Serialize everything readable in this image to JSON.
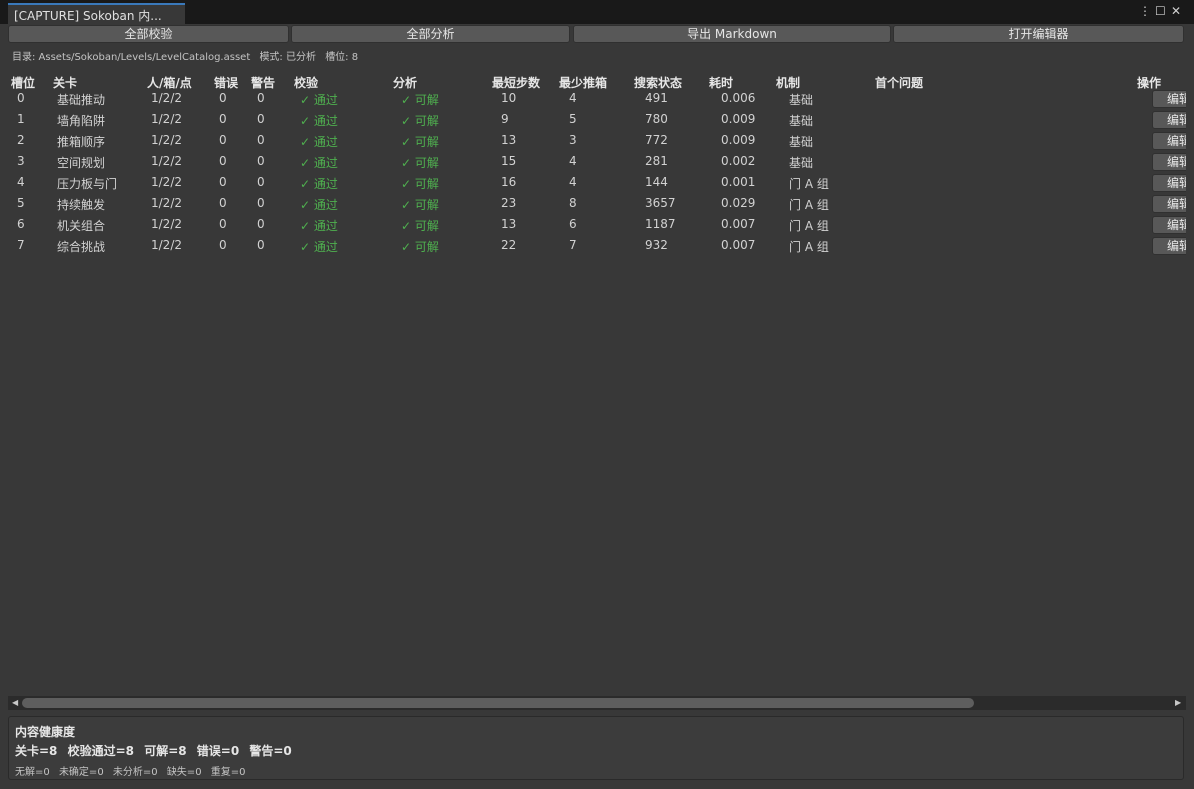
{
  "window": {
    "tab_title": "[CAPTURE] Sokoban 内...",
    "menu_glyph": "⋮",
    "maximize_glyph": "☐",
    "close_glyph": "✕"
  },
  "toolbar": {
    "validate_all": "全部校验",
    "analyze_all": "全部分析",
    "export_markdown": "导出 Markdown",
    "open_editor": "打开编辑器"
  },
  "info": {
    "catalog": "目录: Assets/Sokoban/Levels/LevelCatalog.asset",
    "mode": "模式: 已分析",
    "slots": "槽位: 8"
  },
  "table": {
    "headers": [
      "槽位",
      "关卡",
      "人/箱/点",
      "错误",
      "警告",
      "校验",
      "分析",
      "最短步数",
      "最少推箱",
      "搜索状态",
      "耗时",
      "机制",
      "首个问题",
      "操作"
    ],
    "rows": [
      {
        "slot": "0",
        "level": "基础推动",
        "pbg": "1/2/2",
        "errors": "0",
        "warnings": "0",
        "validation": "✓ 通过",
        "analysis": "✓ 可解",
        "min_steps": "10",
        "min_pushes": "4",
        "states": "491",
        "time": "0.006",
        "mechanic": "基础",
        "first_issue": "",
        "action": "编辑"
      },
      {
        "slot": "1",
        "level": "墙角陷阱",
        "pbg": "1/2/2",
        "errors": "0",
        "warnings": "0",
        "validation": "✓ 通过",
        "analysis": "✓ 可解",
        "min_steps": "9",
        "min_pushes": "5",
        "states": "780",
        "time": "0.009",
        "mechanic": "基础",
        "first_issue": "",
        "action": "编辑"
      },
      {
        "slot": "2",
        "level": "推箱顺序",
        "pbg": "1/2/2",
        "errors": "0",
        "warnings": "0",
        "validation": "✓ 通过",
        "analysis": "✓ 可解",
        "min_steps": "13",
        "min_pushes": "3",
        "states": "772",
        "time": "0.009",
        "mechanic": "基础",
        "first_issue": "",
        "action": "编辑"
      },
      {
        "slot": "3",
        "level": "空间规划",
        "pbg": "1/2/2",
        "errors": "0",
        "warnings": "0",
        "validation": "✓ 通过",
        "analysis": "✓ 可解",
        "min_steps": "15",
        "min_pushes": "4",
        "states": "281",
        "time": "0.002",
        "mechanic": "基础",
        "first_issue": "",
        "action": "编辑"
      },
      {
        "slot": "4",
        "level": "压力板与门",
        "pbg": "1/2/2",
        "errors": "0",
        "warnings": "0",
        "validation": "✓ 通过",
        "analysis": "✓ 可解",
        "min_steps": "16",
        "min_pushes": "4",
        "states": "144",
        "time": "0.001",
        "mechanic": "门 A 组",
        "first_issue": "",
        "action": "编辑"
      },
      {
        "slot": "5",
        "level": "持续触发",
        "pbg": "1/2/2",
        "errors": "0",
        "warnings": "0",
        "validation": "✓ 通过",
        "analysis": "✓ 可解",
        "min_steps": "23",
        "min_pushes": "8",
        "states": "3657",
        "time": "0.029",
        "mechanic": "门 A 组",
        "first_issue": "",
        "action": "编辑"
      },
      {
        "slot": "6",
        "level": "机关组合",
        "pbg": "1/2/2",
        "errors": "0",
        "warnings": "0",
        "validation": "✓ 通过",
        "analysis": "✓ 可解",
        "min_steps": "13",
        "min_pushes": "6",
        "states": "1187",
        "time": "0.007",
        "mechanic": "门 A 组",
        "first_issue": "",
        "action": "编辑"
      },
      {
        "slot": "7",
        "level": "综合挑战",
        "pbg": "1/2/2",
        "errors": "0",
        "warnings": "0",
        "validation": "✓ 通过",
        "analysis": "✓ 可解",
        "min_steps": "22",
        "min_pushes": "7",
        "states": "932",
        "time": "0.007",
        "mechanic": "门 A 组",
        "first_issue": "",
        "action": "编辑"
      }
    ]
  },
  "scrollbar": {
    "left_arrow": "◀",
    "right_arrow": "▶"
  },
  "health": {
    "title": "内容健康度",
    "summary": [
      "关卡=8",
      "校验通过=8",
      "可解=8",
      "错误=0",
      "警告=0"
    ],
    "details": [
      "无解=0",
      "未确定=0",
      "未分析=0",
      "缺失=0",
      "重复=0"
    ]
  },
  "colors": {
    "background": "#383838",
    "ok_green": "#4fb04f",
    "tab_accent": "#3a79bb"
  }
}
